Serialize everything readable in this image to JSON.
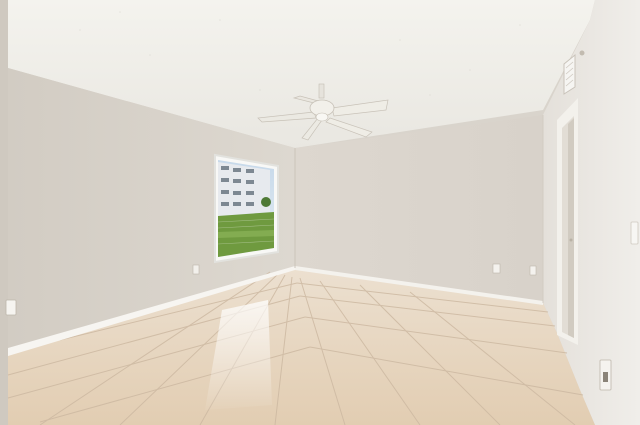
{
  "scene": {
    "kind": "photo-empty-room",
    "objects": [
      "ceiling-fan",
      "window",
      "doorway",
      "tile-floor",
      "outlets",
      "vent",
      "wall-switch"
    ]
  },
  "colors": {
    "ceiling": "#f1f0ea",
    "left_wall": "#d6d0c7",
    "back_wall": "#dcd6ce",
    "right_wall": "#e9e6e0",
    "floor": "#e8d7c2",
    "floor_grout": "#cdb9a2",
    "baseboard": "#f6f4ef",
    "window_sky": "#cfe0ee",
    "window_building": "#e6e9ec",
    "window_grass": "#6f9a3f",
    "fan": "#efede6"
  }
}
